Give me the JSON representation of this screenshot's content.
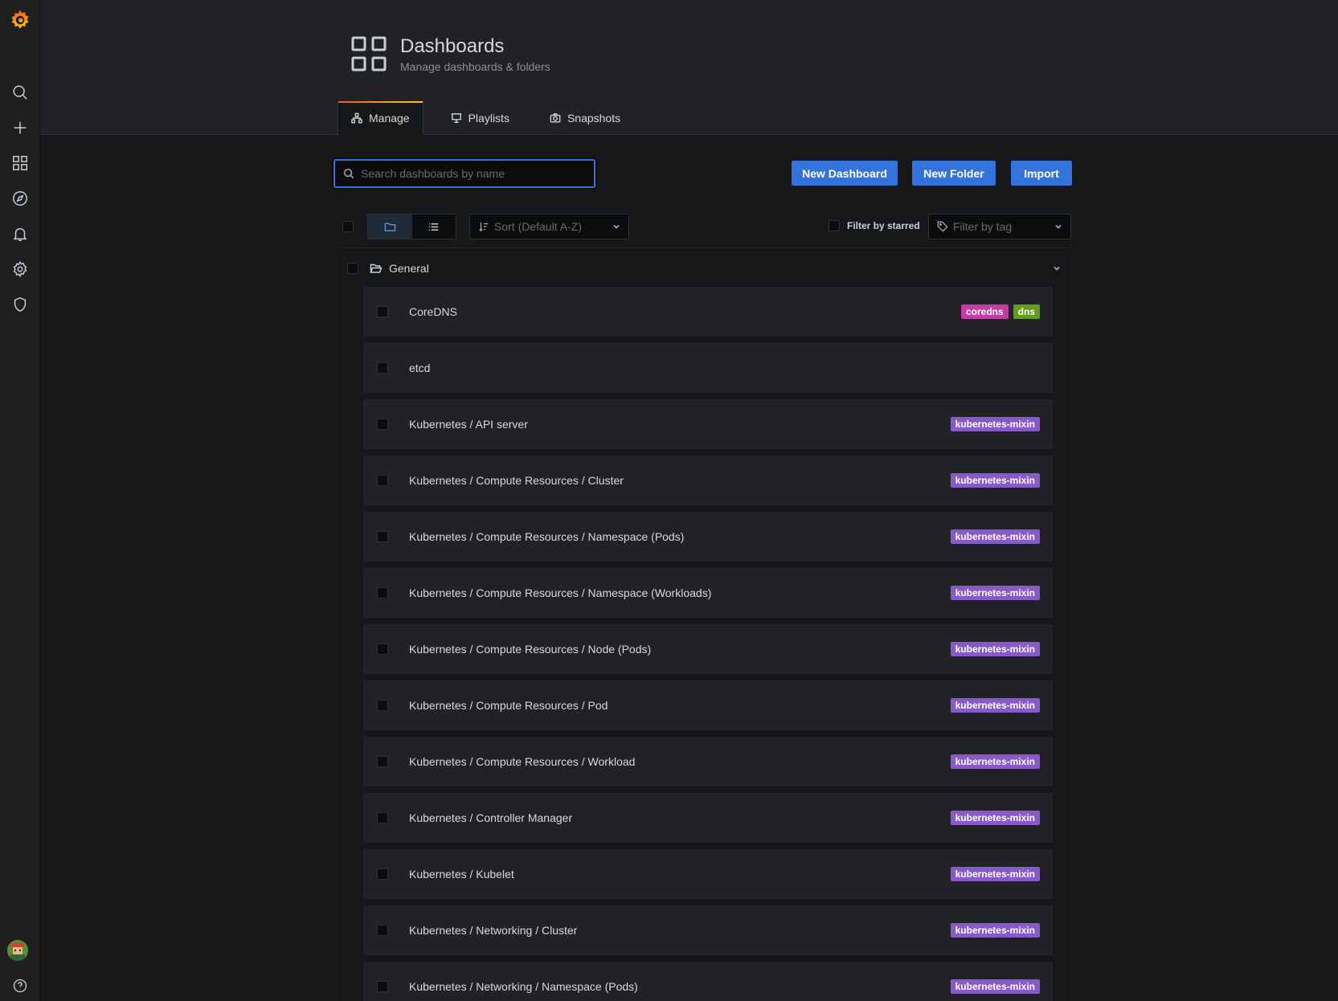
{
  "header": {
    "title": "Dashboards",
    "subtitle": "Manage dashboards & folders",
    "tabs": [
      {
        "label": "Manage",
        "icon": "sitemap-icon",
        "active": true
      },
      {
        "label": "Playlists",
        "icon": "presentation-icon",
        "active": false
      },
      {
        "label": "Snapshots",
        "icon": "camera-icon",
        "active": false
      }
    ]
  },
  "sidebar": {
    "items": [
      "search-icon",
      "plus-icon",
      "apps-icon",
      "compass-icon",
      "bell-icon",
      "cog-icon",
      "shield-icon"
    ],
    "bottom": [
      "avatar",
      "help-icon"
    ]
  },
  "toolbar": {
    "search_placeholder": "Search dashboards by name",
    "new_dashboard": "New Dashboard",
    "new_folder": "New Folder",
    "import": "Import",
    "sort": "Sort (Default A-Z)",
    "filter_starred": "Filter by starred",
    "filter_tag": "Filter by tag"
  },
  "folder": {
    "name": "General"
  },
  "tag_colors": {
    "coredns": "#c33ba4",
    "dns": "#629e1a",
    "kubernetes-mixin": "#8859c9"
  },
  "dashboards": [
    {
      "title": "CoreDNS",
      "tags": [
        "coredns",
        "dns"
      ]
    },
    {
      "title": "etcd",
      "tags": []
    },
    {
      "title": "Kubernetes / API server",
      "tags": [
        "kubernetes-mixin"
      ]
    },
    {
      "title": "Kubernetes / Compute Resources / Cluster",
      "tags": [
        "kubernetes-mixin"
      ]
    },
    {
      "title": "Kubernetes / Compute Resources / Namespace (Pods)",
      "tags": [
        "kubernetes-mixin"
      ]
    },
    {
      "title": "Kubernetes / Compute Resources / Namespace (Workloads)",
      "tags": [
        "kubernetes-mixin"
      ]
    },
    {
      "title": "Kubernetes / Compute Resources / Node (Pods)",
      "tags": [
        "kubernetes-mixin"
      ]
    },
    {
      "title": "Kubernetes / Compute Resources / Pod",
      "tags": [
        "kubernetes-mixin"
      ]
    },
    {
      "title": "Kubernetes / Compute Resources / Workload",
      "tags": [
        "kubernetes-mixin"
      ]
    },
    {
      "title": "Kubernetes / Controller Manager",
      "tags": [
        "kubernetes-mixin"
      ]
    },
    {
      "title": "Kubernetes / Kubelet",
      "tags": [
        "kubernetes-mixin"
      ]
    },
    {
      "title": "Kubernetes / Networking / Cluster",
      "tags": [
        "kubernetes-mixin"
      ]
    },
    {
      "title": "Kubernetes / Networking / Namespace (Pods)",
      "tags": [
        "kubernetes-mixin"
      ]
    }
  ]
}
